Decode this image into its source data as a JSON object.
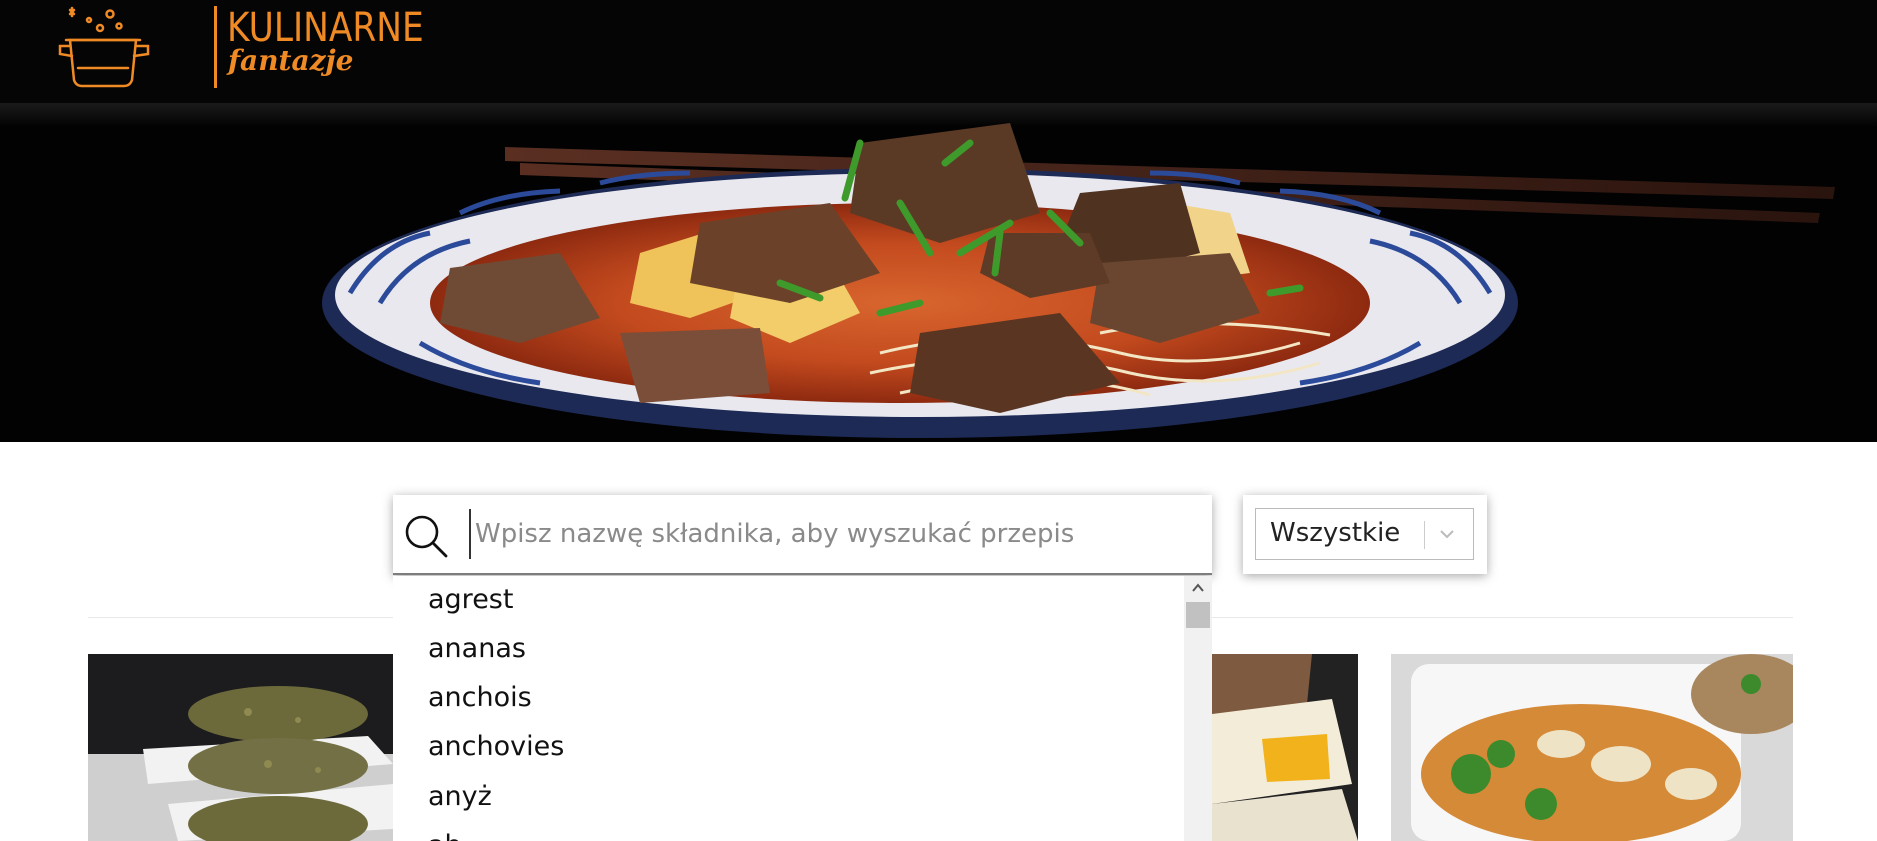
{
  "header": {
    "logo_line1": "KULINARNE",
    "logo_line2": "fantazje"
  },
  "search": {
    "placeholder": "Wpisz nazwę składnika, aby wyszukać przepis",
    "value": ""
  },
  "filter": {
    "selected": "Wszystkie"
  },
  "autocomplete": {
    "items": [
      "agrest",
      "ananas",
      "anchois",
      "anchovies",
      "anyż",
      "ab..."
    ]
  },
  "colors": {
    "brand_orange": "#f08a24",
    "header_bg": "#050505"
  },
  "icons": {
    "search": "search-icon",
    "chevron": "chevron-down-icon",
    "logo": "pot-icon"
  }
}
